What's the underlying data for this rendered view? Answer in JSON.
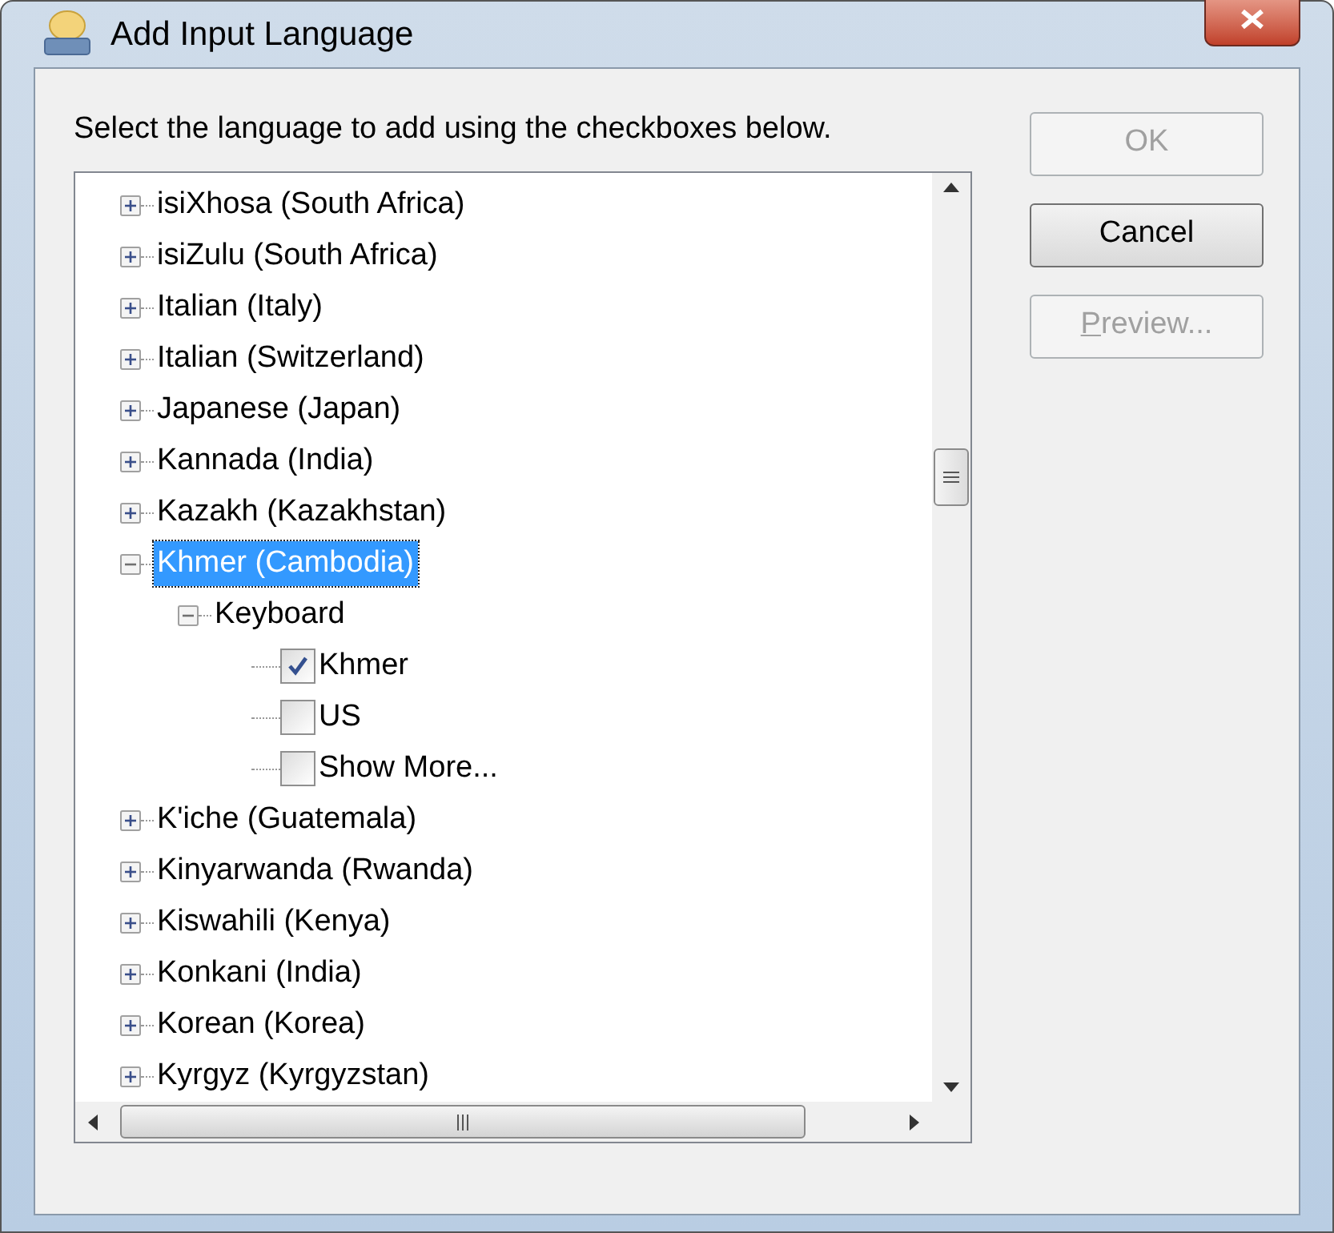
{
  "window": {
    "title": "Add Input Language"
  },
  "instruction": "Select the language to add using the checkboxes below.",
  "tree": [
    {
      "label": "isiXhosa (South Africa)",
      "expanded": false,
      "selected": false
    },
    {
      "label": "isiZulu (South Africa)",
      "expanded": false,
      "selected": false
    },
    {
      "label": "Italian (Italy)",
      "expanded": false,
      "selected": false
    },
    {
      "label": "Italian (Switzerland)",
      "expanded": false,
      "selected": false
    },
    {
      "label": "Japanese (Japan)",
      "expanded": false,
      "selected": false
    },
    {
      "label": "Kannada (India)",
      "expanded": false,
      "selected": false
    },
    {
      "label": "Kazakh (Kazakhstan)",
      "expanded": false,
      "selected": false
    },
    {
      "label": "Khmer (Cambodia)",
      "expanded": true,
      "selected": true,
      "children": [
        {
          "label": "Keyboard",
          "expanded": true,
          "selected": false,
          "children": [
            {
              "label": "Khmer",
              "kind": "checkbox",
              "checked": true
            },
            {
              "label": "US",
              "kind": "checkbox",
              "checked": false
            },
            {
              "label": "Show More...",
              "kind": "checkbox",
              "checked": false
            }
          ]
        }
      ]
    },
    {
      "label": "K'iche (Guatemala)",
      "expanded": false,
      "selected": false
    },
    {
      "label": "Kinyarwanda (Rwanda)",
      "expanded": false,
      "selected": false
    },
    {
      "label": "Kiswahili (Kenya)",
      "expanded": false,
      "selected": false
    },
    {
      "label": "Konkani (India)",
      "expanded": false,
      "selected": false
    },
    {
      "label": "Korean (Korea)",
      "expanded": false,
      "selected": false
    },
    {
      "label": "Kyrgyz (Kyrgyzstan)",
      "expanded": false,
      "selected": false
    }
  ],
  "buttons": [
    {
      "label": "OK",
      "disabled": true
    },
    {
      "label": "Cancel",
      "disabled": false
    },
    {
      "label": "Preview...",
      "disabled": true,
      "mnemonic": true
    }
  ]
}
